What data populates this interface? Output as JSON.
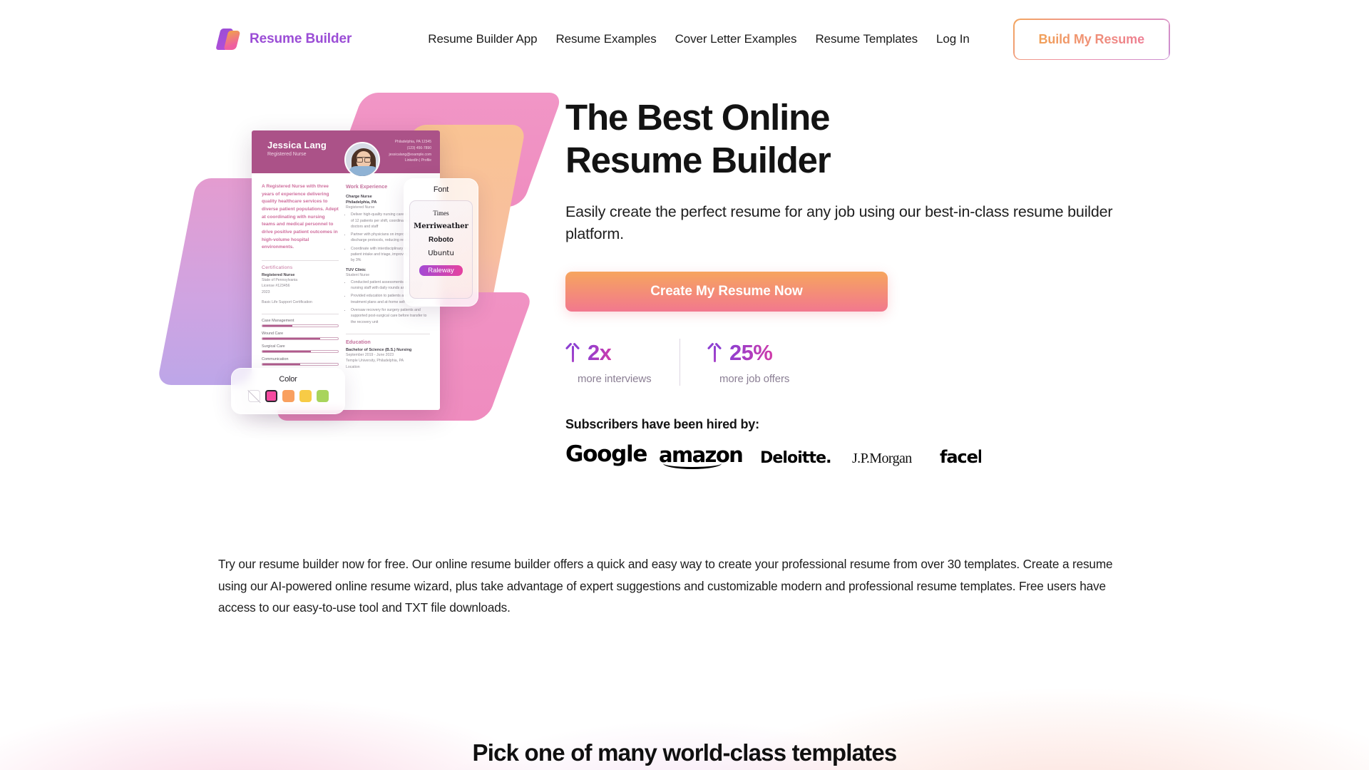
{
  "brand": {
    "name": "Resume Builder",
    "color": "#9b4dd6"
  },
  "nav": {
    "links": [
      {
        "label": "Resume Builder App"
      },
      {
        "label": "Resume Examples"
      },
      {
        "label": "Cover Letter Examples"
      },
      {
        "label": "Resume Templates"
      },
      {
        "label": "Log In"
      }
    ],
    "cta_label": "Build My Resume"
  },
  "hero": {
    "heading_line1": "The Best Online",
    "heading_line2": "Resume Builder",
    "subheading": "Easily create the perfect resume for any job using our best-in-class resume builder platform.",
    "cta_label": "Create My Resume Now",
    "cta_gradient_from": "#f6a55e",
    "cta_gradient_to": "#f2788e",
    "stats": [
      {
        "icon": "arrow-up-icon",
        "value": "2x",
        "label": "more interviews"
      },
      {
        "icon": "arrow-up-icon",
        "value": "25%",
        "label": "more job offers"
      }
    ],
    "hired_label": "Subscribers have been hired by:",
    "logos": [
      {
        "name": "Google"
      },
      {
        "name": "amazon"
      },
      {
        "name": "Deloitte."
      },
      {
        "name": "J.P.Morgan"
      },
      {
        "name": "faceb"
      }
    ]
  },
  "resume_preview": {
    "name": "Jessica Lang",
    "role": "Registered Nurse",
    "contact": [
      "Philadelphia, PA 12345",
      "(123) 456-7890",
      "jessicalang@example.com",
      "LinkedIn | Profile"
    ],
    "summary": "A Registered Nurse with three years of experience delivering quality healthcare services to diverse patient populations. Adept at coordinating with nursing teams and medical personnel to drive positive patient outcomes in high-volume hospital environments.",
    "certifications_title": "Certifications",
    "certifications": [
      {
        "name": "Registered Nurse",
        "lines": [
          "State of Pennsylvania",
          "License #123456",
          "2023"
        ]
      },
      {
        "name": "Basic Life Support Certification",
        "lines": []
      }
    ],
    "skills": [
      {
        "label": "Case Management",
        "value": 40
      },
      {
        "label": "Wound Care",
        "value": 76
      },
      {
        "label": "Surgical Care",
        "value": 64
      },
      {
        "label": "Communication",
        "value": 50
      }
    ],
    "work_title": "Work Experience",
    "work": [
      {
        "job": "Charge Nurse",
        "meta": "Philadelphia, PA",
        "sub": "Registered Nurse",
        "bullets": [
          "Deliver high-quality nursing care to an average of 12 patients per shift, coordinating with doctors and staff",
          "Partner with physicians on improving patient discharge protocols, reducing readmissions",
          "Coordinate with interdisciplinary teams on patient intake and triage, improving throughput by 3%"
        ]
      },
      {
        "job": "TUV Clinic",
        "meta": "Student Nurse",
        "sub": "",
        "bullets": [
          "Conducted patient assessments and supported nursing staff with daily rounds and charting",
          "Provided education to patients and families on treatment plans and at-home self care",
          "Oversaw recovery for surgery patients and supported post-surgical care before transfer to the recovery unit"
        ]
      }
    ],
    "education_title": "Education",
    "education": {
      "degree": "Bachelor of Science (B.S.) Nursing",
      "dates": "September 2019 - June 2023",
      "school": "Temple University, Philadelphia, PA",
      "location": "Location"
    }
  },
  "font_panel": {
    "title": "Font",
    "options": [
      "Times",
      "Merriweather",
      "Roboto",
      "Ubuntu"
    ],
    "selected": "Raleway"
  },
  "color_panel": {
    "title": "Color",
    "swatches": [
      {
        "name": "none",
        "hex": "#ffffff",
        "selected": false
      },
      {
        "name": "pink",
        "hex": "#f54ba0",
        "selected": true
      },
      {
        "name": "orange",
        "hex": "#f9a05f",
        "selected": false
      },
      {
        "name": "yellow",
        "hex": "#f7cb46",
        "selected": false
      },
      {
        "name": "green",
        "hex": "#a8d45c",
        "selected": false
      }
    ]
  },
  "intro_paragraph": "Try our resume builder now for free. Our online resume builder offers a quick and easy way to create your professional resume from over 30 templates. Create a resume using our AI-powered online resume wizard, plus take advantage of expert suggestions and customizable modern and professional resume templates. Free users have access to our easy-to-use tool and TXT file downloads.",
  "bottom_section": {
    "title": "Pick one of many world-class templates"
  }
}
